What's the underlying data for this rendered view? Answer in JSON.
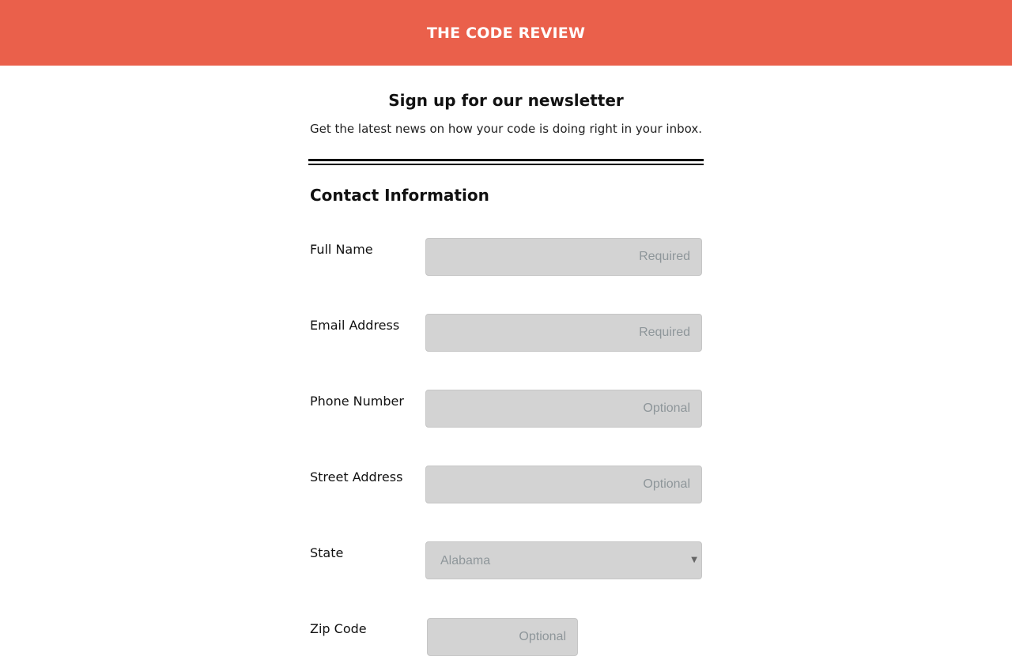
{
  "header": {
    "title": "THE CODE REVIEW",
    "background_color": "#ea604b"
  },
  "newsletter": {
    "heading": "Sign up for our newsletter",
    "subheading": "Get the latest news on how your code is doing right in your inbox."
  },
  "contact": {
    "heading": "Contact Information",
    "fields": [
      {
        "label": "Full Name",
        "placeholder": "Required",
        "value": ""
      },
      {
        "label": "Email Address",
        "placeholder": "Required",
        "value": ""
      },
      {
        "label": "Phone Number",
        "placeholder": "Optional",
        "value": ""
      },
      {
        "label": "Street Address",
        "placeholder": "Optional",
        "value": ""
      },
      {
        "label": "State",
        "selected": "Alabama"
      },
      {
        "label": "Zip Code",
        "placeholder": "Optional",
        "value": ""
      }
    ]
  }
}
